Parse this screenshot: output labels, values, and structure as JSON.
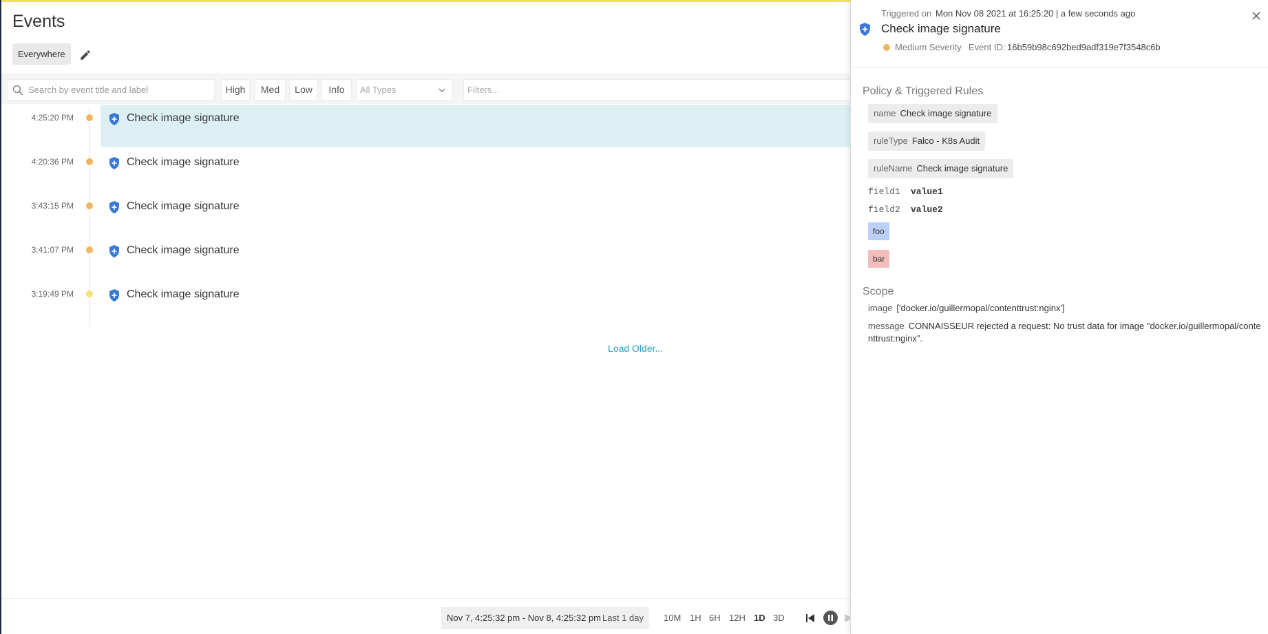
{
  "page": {
    "title": "Events"
  },
  "scope": {
    "label": "Everywhere"
  },
  "toolbar": {
    "search_placeholder": "Search by event title and label",
    "severity_buttons": [
      "High",
      "Med",
      "Low",
      "Info"
    ],
    "type_select": "All Types",
    "filters_placeholder": "Filters..."
  },
  "events": [
    {
      "time": "4:25:20 PM",
      "title": "Check image signature",
      "severity_color": "#f0b55e",
      "selected": true
    },
    {
      "time": "4:20:36 PM",
      "title": "Check image signature",
      "severity_color": "#f0b55e",
      "selected": false
    },
    {
      "time": "3:43:15 PM",
      "title": "Check image signature",
      "severity_color": "#f0b55e",
      "selected": false
    },
    {
      "time": "3:41:07 PM",
      "title": "Check image signature",
      "severity_color": "#f0b55e",
      "selected": false
    },
    {
      "time": "3:19:49 PM",
      "title": "Check image signature",
      "severity_color": "#f5e27a",
      "selected": false
    }
  ],
  "load_older": "Load Older...",
  "timerange": {
    "range": "Nov 7, 4:25:32 pm - Nov 8, 4:25:32 pm",
    "duration": "Last 1 day",
    "zoom_options": [
      "10M",
      "1H",
      "6H",
      "12H",
      "1D",
      "3D"
    ],
    "active_zoom": "1D"
  },
  "panel": {
    "triggered_label": "Triggered on",
    "triggered_value": "Mon Nov 08 2021 at 16:25:20 | a few seconds ago",
    "title": "Check image signature",
    "severity": "Medium Severity",
    "event_id_label": "Event ID:",
    "event_id": "16b59b98c692bed9adf319e7f3548c6b",
    "policy_section": "Policy & Triggered Rules",
    "rules": [
      {
        "key": "name",
        "value": "Check image signature"
      },
      {
        "key": "ruleType",
        "value": "Falco - K8s Audit"
      },
      {
        "key": "ruleName",
        "value": "Check image signature"
      }
    ],
    "fields": [
      {
        "key": "field1",
        "value": "value1"
      },
      {
        "key": "field2",
        "value": "value2"
      }
    ],
    "tags": [
      {
        "label": "foo",
        "color": "#bcd0f7"
      },
      {
        "label": "bar",
        "color": "#f5bcbc"
      }
    ],
    "scope_section": "Scope",
    "scope_image_key": "image",
    "scope_image_value": "['docker.io/guillermopal/contenttrust:nginx']",
    "scope_message_key": "message",
    "scope_message_value": "CONNAISSEUR rejected a request: No trust data for image \"docker.io/guillermopal/contenttrust:nginx\"."
  },
  "colors": {
    "accent": "#2a9fc4",
    "selected_row": "#dcf0f3",
    "shield": "#3a78d6",
    "top_bar": "#f2e34b"
  }
}
